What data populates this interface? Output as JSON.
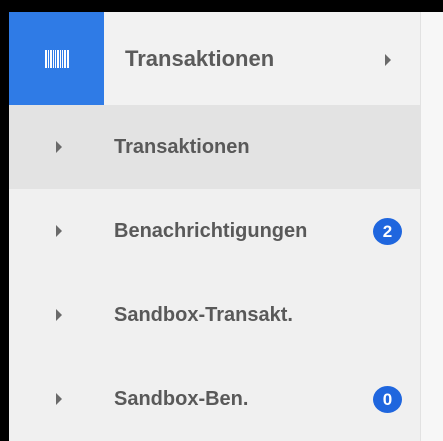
{
  "header": {
    "icon": "barcode-icon",
    "title": "Transaktionen",
    "arrow_icon": "chevron-right-icon",
    "accent_color": "#2f7be6"
  },
  "menu": {
    "items": [
      {
        "label": "Transaktionen",
        "active": true
      },
      {
        "label": "Benachrichtigungen",
        "badge": "2"
      },
      {
        "label": "Sandbox-Transakt."
      },
      {
        "label": "Sandbox-Ben.",
        "badge": "0"
      }
    ],
    "badge_color": "#1f66de"
  }
}
